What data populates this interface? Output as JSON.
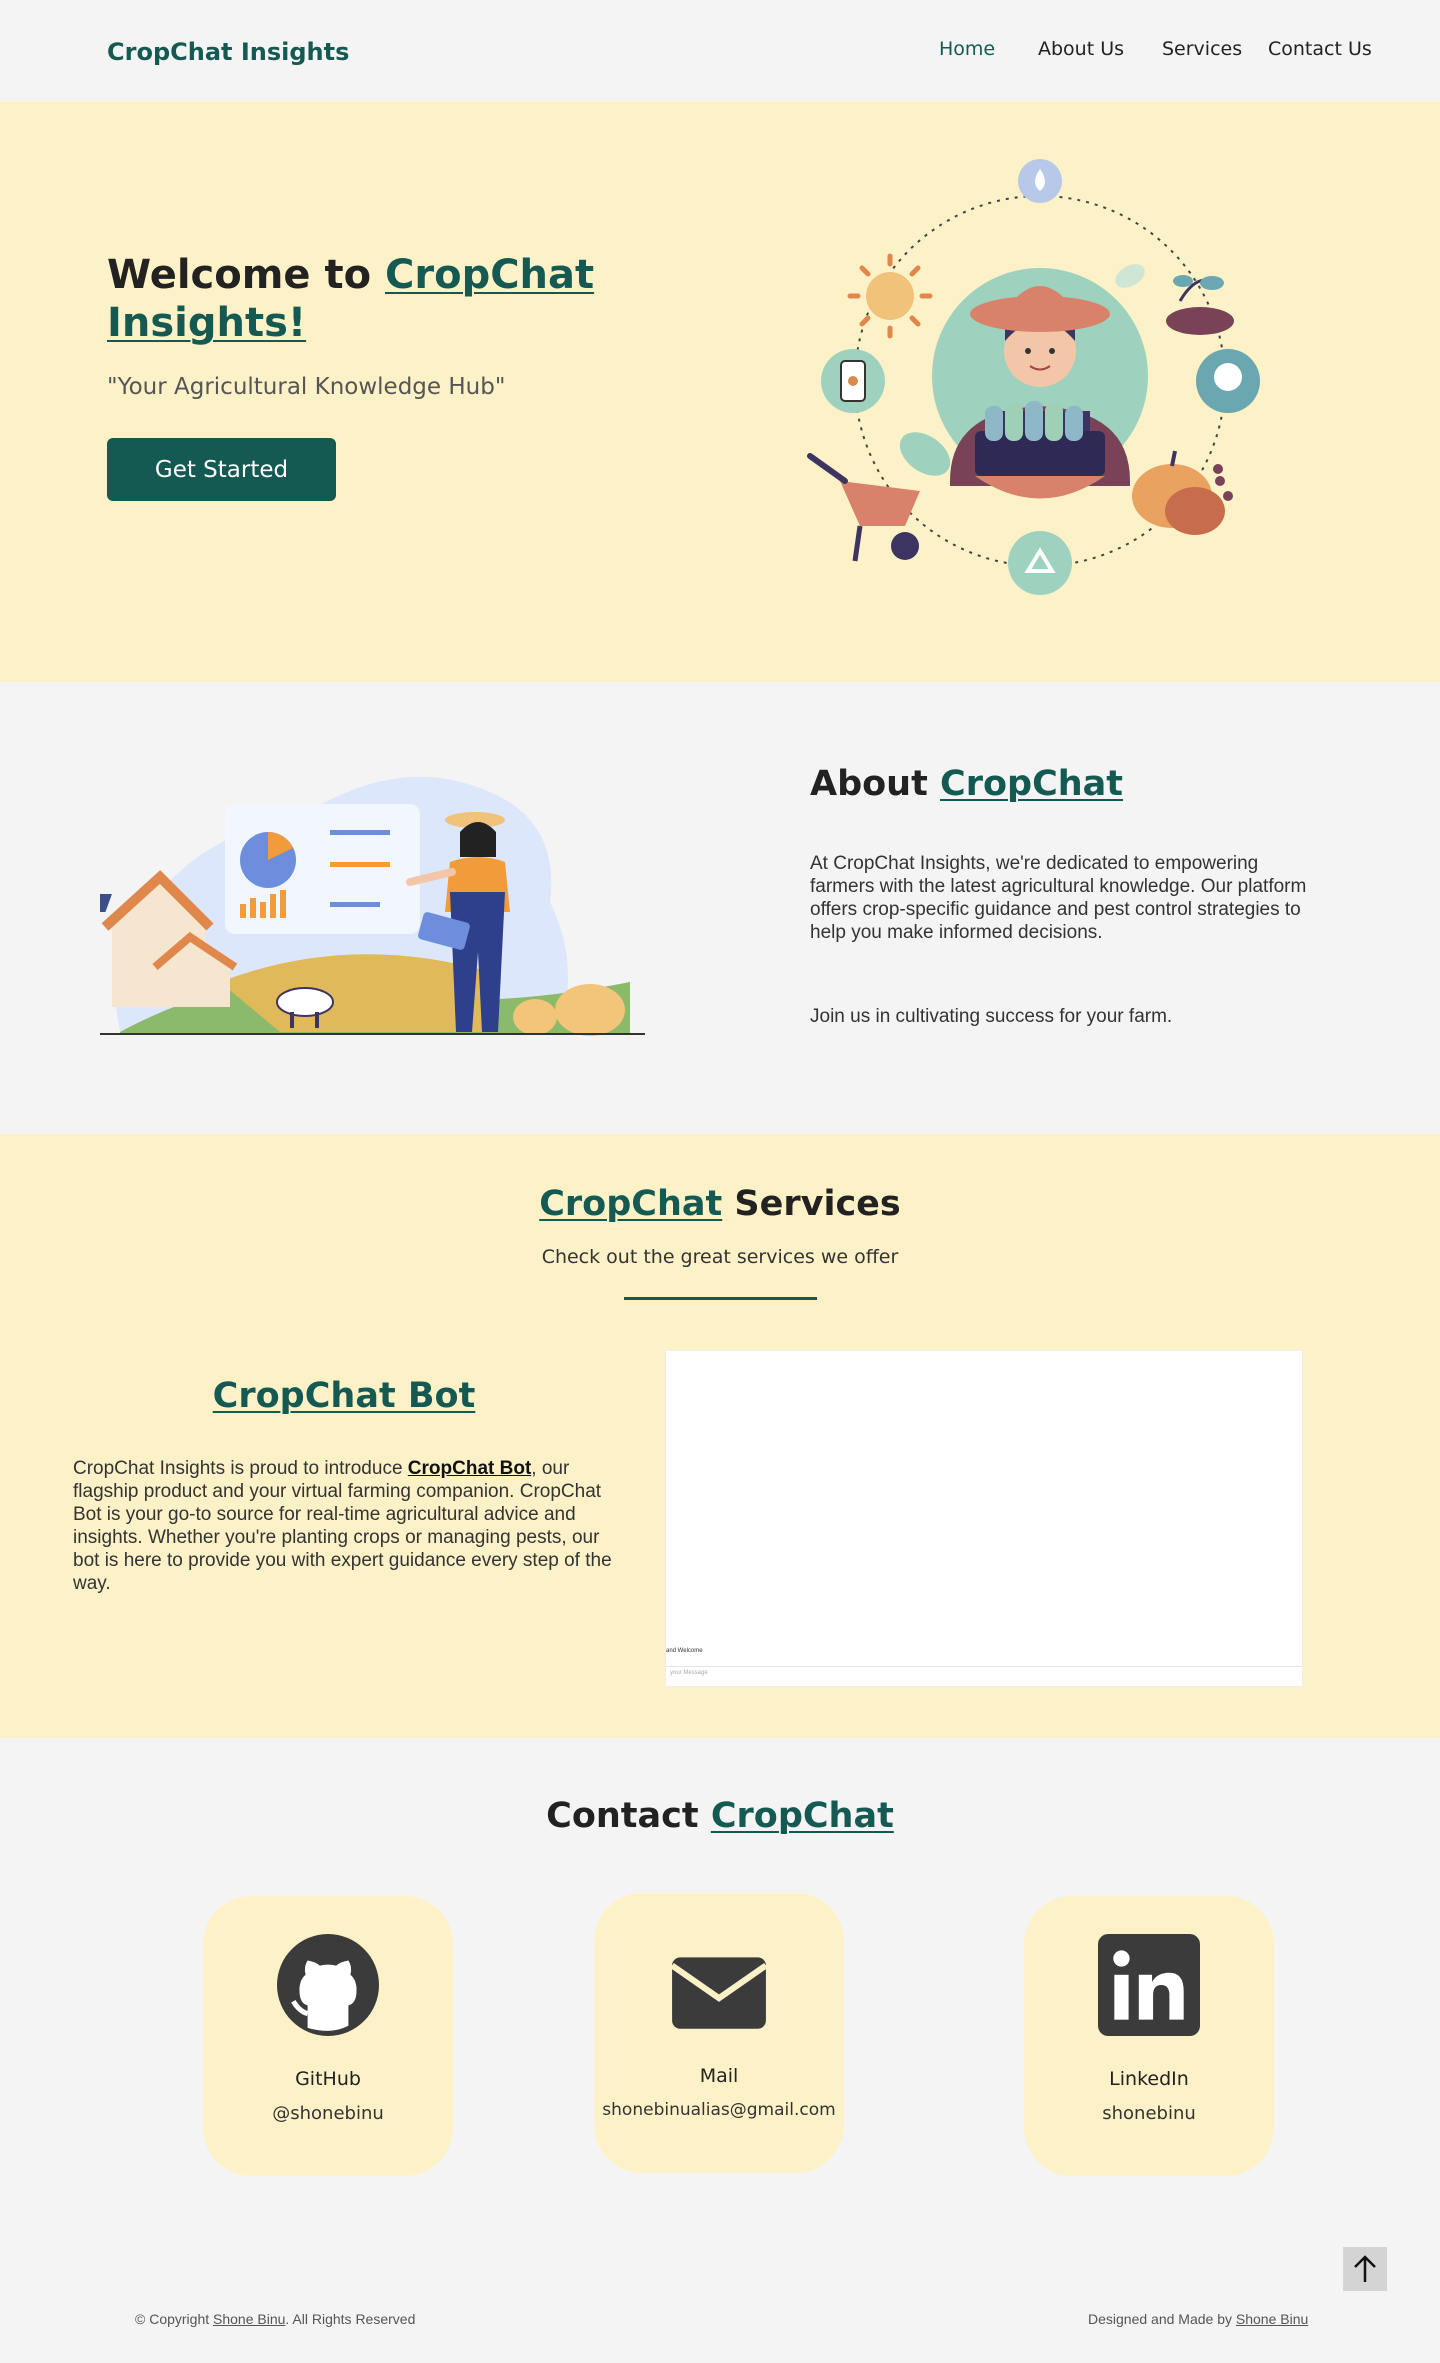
{
  "nav": {
    "brand": "CropChat Insights",
    "links": [
      {
        "label": "Home",
        "active": true
      },
      {
        "label": "About Us",
        "active": false
      },
      {
        "label": "Services",
        "active": false
      },
      {
        "label": "Contact Us",
        "active": false
      }
    ]
  },
  "hero": {
    "title_prefix": "Welcome to ",
    "title_accent": "CropChat Insights!",
    "tagline": "\"Your Agricultural Knowledge Hub\"",
    "cta_label": "Get Started"
  },
  "about": {
    "title_prefix": "About ",
    "title_accent": "CropChat",
    "paragraph1": "At CropChat Insights, we're dedicated to empowering farmers with the latest agricultural knowledge. Our platform offers crop-specific guidance and pest control strategies to help you make informed decisions.",
    "paragraph2": "Join us in cultivating success for your farm."
  },
  "services": {
    "title_accent": "CropChat",
    "title_suffix": " Services",
    "subtitle": "Check out the great services we offer",
    "bot_title": "CropChat Bot",
    "bot_desc_prefix": "CropChat Insights is proud to introduce ",
    "bot_desc_link": "CropChat Bot",
    "bot_desc_suffix": ", our flagship product and your virtual farming companion. CropChat Bot is your go-to source for real-time agricultural advice and insights. Whether you're planting crops or managing pests, our bot is here to provide you with expert guidance every step of the way.",
    "chat_welcome": "and Welcome",
    "chat_placeholder": "your Message"
  },
  "contact": {
    "title_prefix": "Contact ",
    "title_accent": "CropChat",
    "cards": [
      {
        "name": "GitHub",
        "handle": "@shonebinu",
        "icon": "github-icon"
      },
      {
        "name": "Mail",
        "handle": "shonebinualias@gmail.com",
        "icon": "mail-icon"
      },
      {
        "name": "LinkedIn",
        "handle": "shonebinu",
        "icon": "linkedin-icon"
      }
    ]
  },
  "footer": {
    "copyright_prefix": "© Copyright ",
    "copyright_name": "Shone Binu",
    "copyright_suffix": ". All Rights Reserved",
    "credit_prefix": "Designed and Made by ",
    "credit_name": "Shone Binu"
  },
  "colors": {
    "brand": "#145a53",
    "cream": "#fdf2c7",
    "background": "#f4f4f4"
  }
}
